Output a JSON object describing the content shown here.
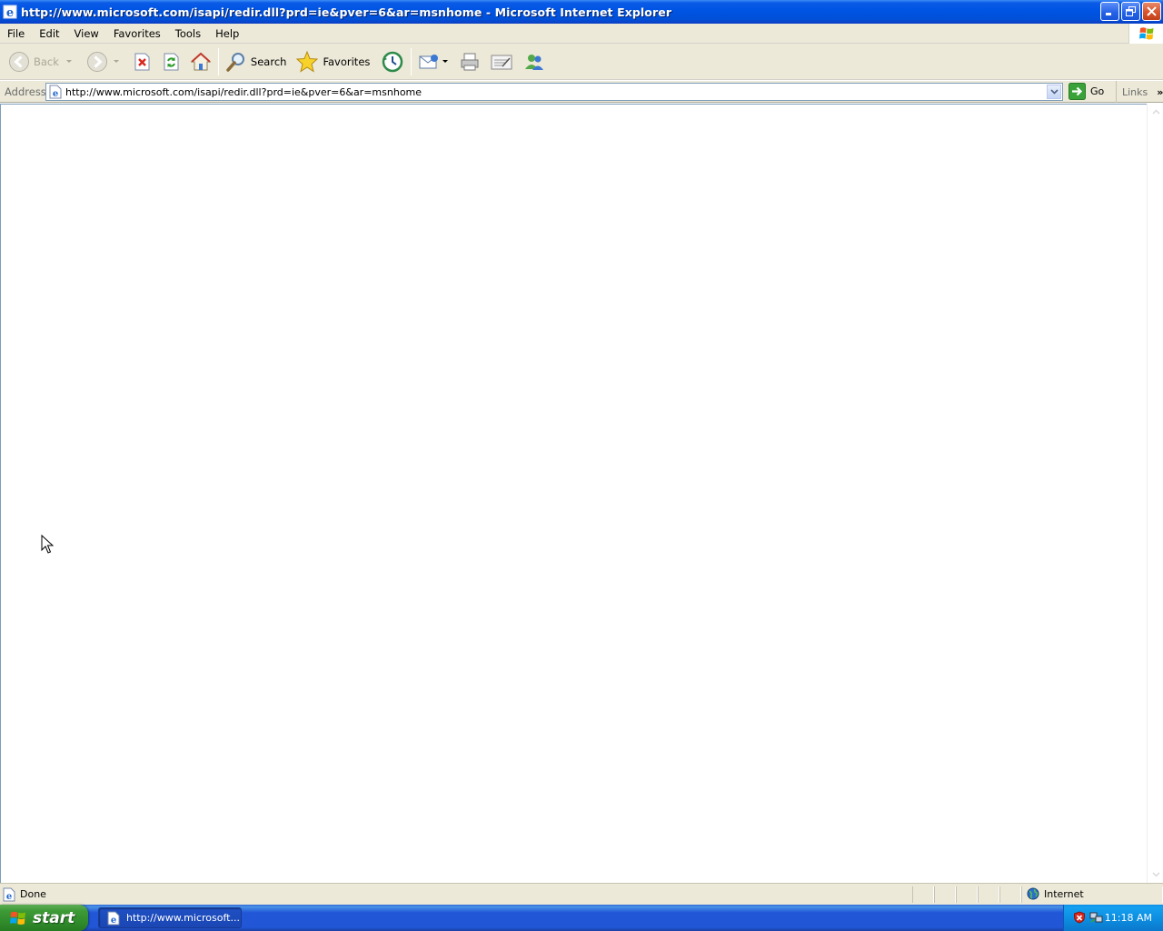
{
  "window": {
    "title": "http://www.microsoft.com/isapi/redir.dll?prd=ie&pver=6&ar=msnhome - Microsoft Internet Explorer"
  },
  "menubar": {
    "items": [
      "File",
      "Edit",
      "View",
      "Favorites",
      "Tools",
      "Help"
    ]
  },
  "toolbar": {
    "back_label": "Back",
    "search_label": "Search",
    "favorites_label": "Favorites"
  },
  "address": {
    "label": "Address",
    "url": "http://www.microsoft.com/isapi/redir.dll?prd=ie&pver=6&ar=msnhome",
    "go_label": "Go",
    "links_label": "Links"
  },
  "status": {
    "text": "Done",
    "zone": "Internet"
  },
  "taskbar": {
    "start_label": "start",
    "task_label": "http://www.microsoft...",
    "clock": "11:18 AM"
  },
  "colors": {
    "titlebar": "#0054e3",
    "chrome": "#ece9d8",
    "start": "#3c9a35",
    "taskbar": "#2157d7"
  }
}
